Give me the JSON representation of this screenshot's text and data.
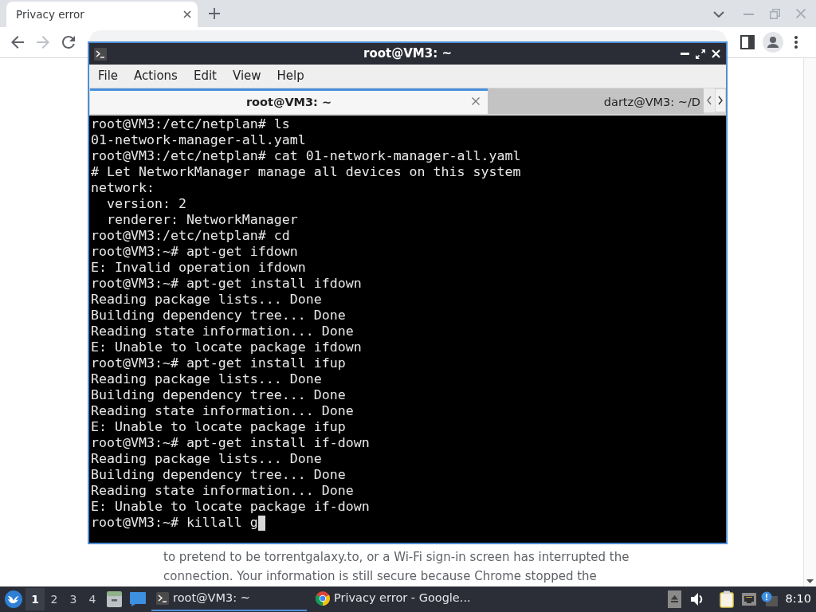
{
  "browser": {
    "tabs": [
      {
        "title": "Privacy error",
        "selected": true
      }
    ],
    "forward_disabled": true,
    "page_lines": [
      "to pretend to be torrentgalaxy.to, or a Wi-Fi sign-in screen has interrupted the",
      "connection. Your information is still secure because Chrome stopped the"
    ]
  },
  "terminal": {
    "title": "root@VM3: ~",
    "menu": [
      "File",
      "Actions",
      "Edit",
      "View",
      "Help"
    ],
    "tabs": [
      {
        "title": "root@VM3: ~",
        "selected": true
      },
      {
        "title": "dartz@VM3: ~/D",
        "selected": false
      }
    ],
    "lines": [
      "root@VM3:/etc/netplan# ls",
      "01-network-manager-all.yaml",
      "root@VM3:/etc/netplan# cat 01-network-manager-all.yaml",
      "# Let NetworkManager manage all devices on this system",
      "network:",
      "  version: 2",
      "  renderer: NetworkManager",
      "root@VM3:/etc/netplan# cd",
      "root@VM3:~# apt-get ifdown",
      "E: Invalid operation ifdown",
      "root@VM3:~# apt-get install ifdown",
      "Reading package lists... Done",
      "Building dependency tree... Done",
      "Reading state information... Done",
      "E: Unable to locate package ifdown",
      "root@VM3:~# apt-get install ifup",
      "Reading package lists... Done",
      "Building dependency tree... Done",
      "Reading state information... Done",
      "E: Unable to locate package ifup",
      "root@VM3:~# apt-get install if-down",
      "Reading package lists... Done",
      "Building dependency tree... Done",
      "Reading state information... Done",
      "E: Unable to locate package if-down",
      "root@VM3:~# killall g"
    ],
    "cursor": true
  },
  "taskbar": {
    "workspaces": [
      {
        "label": "1",
        "selected": true
      },
      {
        "label": "2",
        "selected": false
      },
      {
        "label": "3",
        "selected": false
      },
      {
        "label": "4",
        "selected": false
      }
    ],
    "tasks": [
      {
        "kind": "terminal",
        "title": "root@VM3: ~",
        "selected": true
      },
      {
        "kind": "browser",
        "title": "Privacy error - Google...",
        "selected": false
      }
    ],
    "clock": "8:10"
  }
}
